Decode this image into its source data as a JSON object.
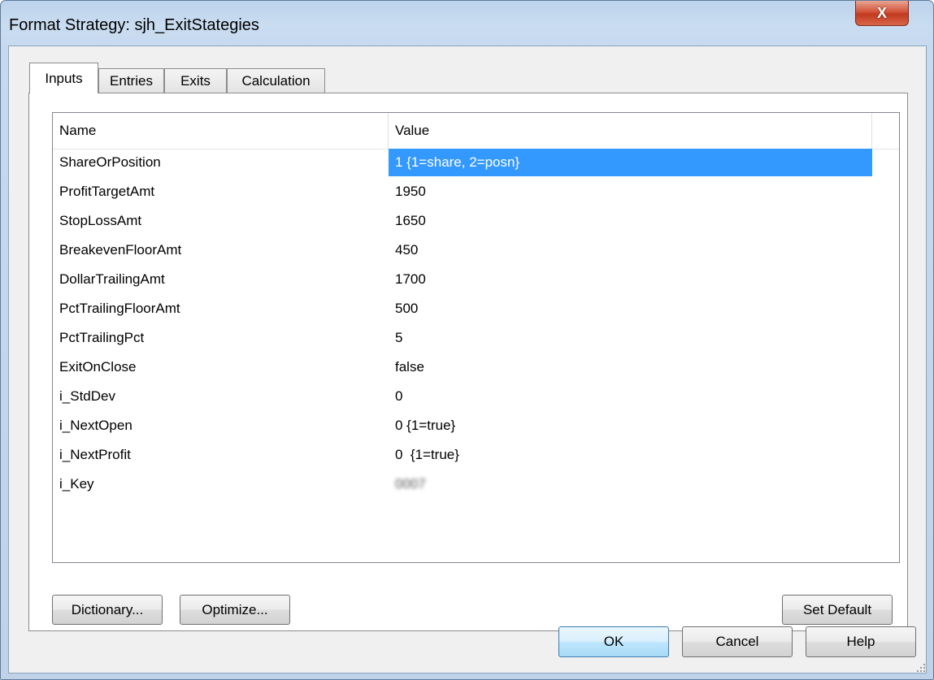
{
  "window": {
    "title": "Format Strategy: sjh_ExitStategies",
    "close_symbol": "X"
  },
  "tabs": [
    {
      "label": "Inputs",
      "active": true
    },
    {
      "label": "Entries",
      "active": false
    },
    {
      "label": "Exits",
      "active": false
    },
    {
      "label": "Calculation",
      "active": false
    }
  ],
  "grid": {
    "columns": [
      "Name",
      "Value"
    ],
    "rows": [
      {
        "name": "ShareOrPosition",
        "value": "1 {1=share, 2=posn}",
        "selected": true
      },
      {
        "name": "ProfitTargetAmt",
        "value": "1950"
      },
      {
        "name": "StopLossAmt",
        "value": "1650"
      },
      {
        "name": "BreakevenFloorAmt",
        "value": "450"
      },
      {
        "name": "DollarTrailingAmt",
        "value": "1700"
      },
      {
        "name": "PctTrailingFloorAmt",
        "value": "500"
      },
      {
        "name": "PctTrailingPct",
        "value": "5"
      },
      {
        "name": "ExitOnClose",
        "value": "false"
      },
      {
        "name": "i_StdDev",
        "value": "0"
      },
      {
        "name": "i_NextOpen",
        "value": "0 {1=true}"
      },
      {
        "name": "i_NextProfit",
        "value": "0  {1=true}"
      },
      {
        "name": "i_Key",
        "value": "0007",
        "blurred": true
      }
    ],
    "selected_color": "#3399ff"
  },
  "panel_buttons": {
    "dictionary": "Dictionary...",
    "optimize": "Optimize...",
    "set_default": "Set Default"
  },
  "dialog_buttons": {
    "ok": "OK",
    "cancel": "Cancel",
    "help": "Help"
  }
}
